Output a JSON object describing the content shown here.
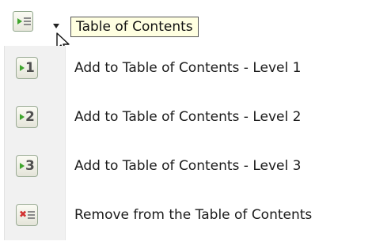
{
  "tooltip": {
    "text": "Table of Contents"
  },
  "toolbar": {
    "button_icon": "table-of-contents-icon",
    "dropdown_icon": "dropdown-arrow-icon"
  },
  "menu": {
    "items": [
      {
        "label": "Add to Table of Contents - Level 1",
        "icon": "toc-level-1-icon",
        "icon_text": "1"
      },
      {
        "label": "Add to Table of Contents - Level 2",
        "icon": "toc-level-2-icon",
        "icon_text": "2"
      },
      {
        "label": "Add to Table of Contents - Level 3",
        "icon": "toc-level-3-icon",
        "icon_text": "3"
      },
      {
        "label": "Remove from the Table of Contents",
        "icon": "toc-remove-icon"
      }
    ]
  },
  "colors": {
    "tooltip_bg": "#ffffe1",
    "gutter_bg": "#f1f1f1",
    "play_green": "#3fa52d",
    "remove_red": "#d23030"
  }
}
